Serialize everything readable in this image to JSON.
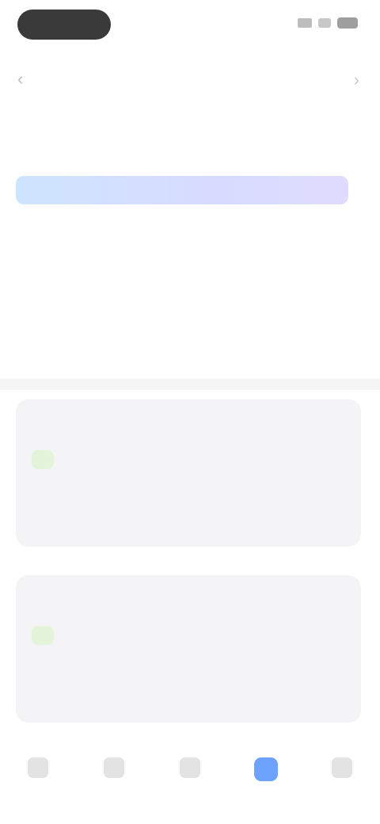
{
  "status": {
    "signal_icon": "signal-icon",
    "wifi_icon": "wifi-icon",
    "battery_icon": "battery-icon"
  },
  "nav": {
    "title": "",
    "back_icon": "back-arrow-icon",
    "more_icon": "more-icon"
  },
  "tabs": [
    {
      "label": ""
    },
    {
      "label": ""
    },
    {
      "label": ""
    }
  ],
  "hero": {
    "title": "",
    "body": ""
  },
  "cards": [
    {
      "title": "",
      "date": "",
      "tag": "",
      "desc": ""
    },
    {
      "title": "",
      "date": "",
      "tag": "",
      "desc": ""
    }
  ],
  "bottom_nav": [
    {
      "label": "",
      "icon": "home-icon"
    },
    {
      "label": "",
      "icon": "grid-icon"
    },
    {
      "label": "",
      "icon": "compass-icon"
    },
    {
      "label": "",
      "icon": "profile-icon"
    },
    {
      "label": "",
      "icon": "settings-icon"
    }
  ],
  "colors": {
    "accent": "#6ea2ff",
    "tag_bg": "#e4f4d8",
    "tag_fg": "#8abf66",
    "hero_gradient_start": "#cfe5ff",
    "hero_gradient_end": "#e0dcff"
  }
}
